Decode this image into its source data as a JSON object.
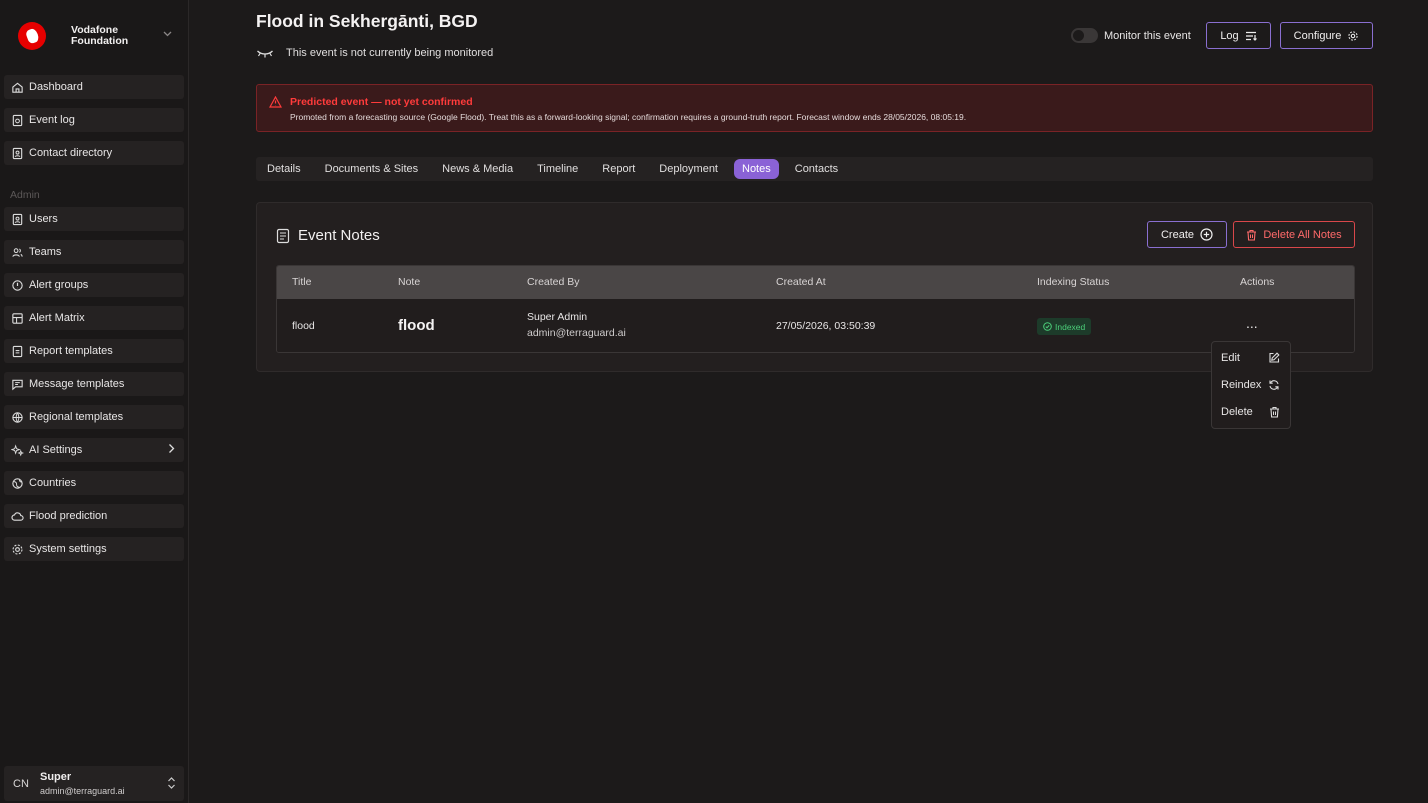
{
  "brand": {
    "line1": "Vodafone",
    "line2": "Foundation",
    "color": "#e60000"
  },
  "sidebar": {
    "items": [
      {
        "label": "Dashboard",
        "icon": "home-icon"
      },
      {
        "label": "Event log",
        "icon": "event-log-icon"
      },
      {
        "label": "Contact directory",
        "icon": "contact-directory-icon"
      }
    ],
    "admin_label": "Admin",
    "admin_items": [
      {
        "label": "Users",
        "icon": "users-icon"
      },
      {
        "label": "Teams",
        "icon": "teams-icon"
      },
      {
        "label": "Alert groups",
        "icon": "alert-groups-icon"
      },
      {
        "label": "Alert Matrix",
        "icon": "alert-matrix-icon"
      },
      {
        "label": "Report templates",
        "icon": "report-templates-icon"
      },
      {
        "label": "Message templates",
        "icon": "message-templates-icon"
      },
      {
        "label": "Regional templates",
        "icon": "globe-icon"
      },
      {
        "label": "AI Settings",
        "icon": "ai-sparkle-icon"
      },
      {
        "label": "Countries",
        "icon": "countries-icon"
      },
      {
        "label": "Flood prediction",
        "icon": "cloud-icon"
      },
      {
        "label": "System settings",
        "icon": "gear-icon"
      }
    ]
  },
  "user": {
    "initials": "CN",
    "name": "Super",
    "email": "admin@terraguard.ai"
  },
  "header": {
    "title": "Flood in Sekhergānti, BGD",
    "monitor_status": "This event is not currently being monitored",
    "monitor_toggle_label": "Monitor this event",
    "monitor_on": false,
    "log_label": "Log",
    "configure_label": "Configure"
  },
  "alert": {
    "title": "Predicted event — not yet confirmed",
    "body": "Promoted from a forecasting source (Google Flood). Treat this as a forward-looking signal; confirmation requires a ground-truth report. Forecast window ends 28/05/2026, 08:05:19.",
    "color": "#ff3b3b"
  },
  "tabs": [
    {
      "label": "Details",
      "active": false
    },
    {
      "label": "Documents & Sites",
      "active": false
    },
    {
      "label": "News & Media",
      "active": false
    },
    {
      "label": "Timeline",
      "active": false
    },
    {
      "label": "Report",
      "active": false
    },
    {
      "label": "Deployment",
      "active": false
    },
    {
      "label": "Notes",
      "active": true
    },
    {
      "label": "Contacts",
      "active": false
    }
  ],
  "notes": {
    "title": "Event Notes",
    "create_label": "Create",
    "delete_all_label": "Delete All Notes",
    "columns": [
      "Title",
      "Note",
      "Created By",
      "Created At",
      "Indexing Status",
      "Actions"
    ],
    "rows": [
      {
        "title": "flood",
        "note": "flood",
        "created_by_name": "Super Admin",
        "created_by_email": "admin@terraguard.ai",
        "created_at": "27/05/2026, 03:50:39",
        "status": "Indexed",
        "actions": "..."
      }
    ]
  },
  "row_menu": {
    "items": [
      {
        "label": "Edit",
        "icon": "edit-icon"
      },
      {
        "label": "Reindex",
        "icon": "refresh-icon"
      },
      {
        "label": "Delete",
        "icon": "trash-icon"
      }
    ]
  },
  "colors": {
    "accent": "#8a62d6",
    "danger": "#d9474a",
    "success": "#4ccf7a"
  }
}
